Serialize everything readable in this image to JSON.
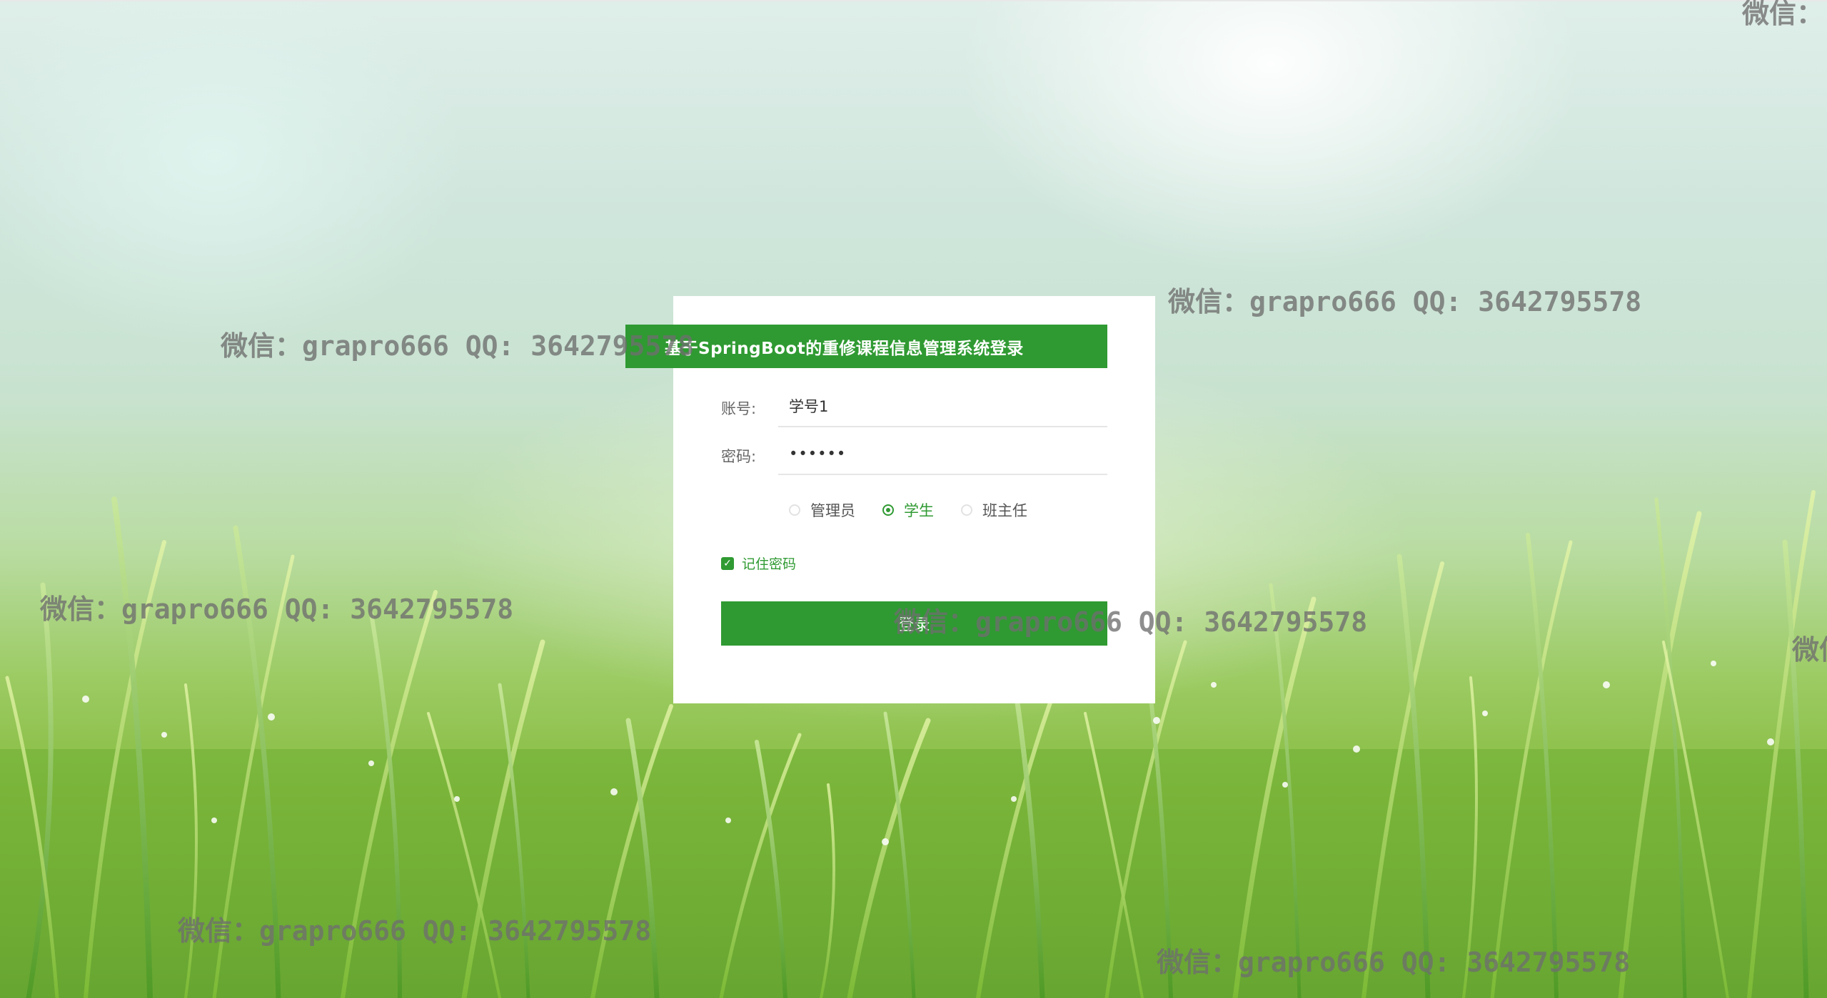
{
  "login": {
    "title": "基于SpringBoot的重修课程信息管理系统登录",
    "account_label": "账号:",
    "account_value": "学号1",
    "password_label": "密码:",
    "password_value": "••••••",
    "roles": [
      {
        "label": "管理员",
        "checked": false
      },
      {
        "label": "学生",
        "checked": true
      },
      {
        "label": "班主任",
        "checked": false
      }
    ],
    "remember_label": "记住密码",
    "remember_checked": true,
    "submit_label": "登录"
  },
  "watermark": {
    "text": "微信：grapro666 QQ: 3642795578",
    "partial_text": "微信："
  },
  "colors": {
    "accent": "#2f9a32",
    "card_background": "#ffffff"
  }
}
